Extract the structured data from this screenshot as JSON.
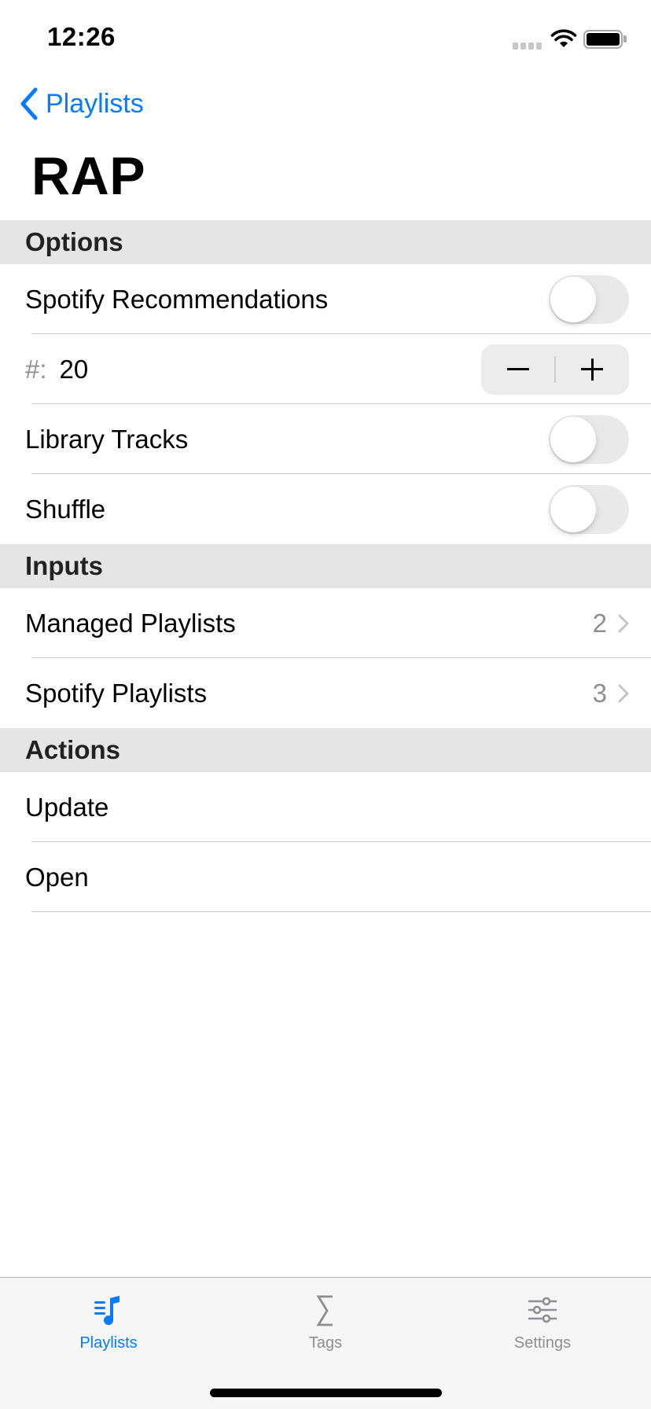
{
  "status_bar": {
    "time": "12:26"
  },
  "nav": {
    "back_label": "Playlists",
    "title": "RAP"
  },
  "sections": [
    {
      "header": "Options",
      "rows": [
        {
          "label": "Spotify Recommendations",
          "type": "toggle",
          "value": false
        },
        {
          "prefix": "#:",
          "label": "20",
          "type": "stepper",
          "value": 20
        },
        {
          "label": "Library Tracks",
          "type": "toggle",
          "value": false
        },
        {
          "label": "Shuffle",
          "type": "toggle",
          "value": false
        }
      ]
    },
    {
      "header": "Inputs",
      "rows": [
        {
          "label": "Managed Playlists",
          "type": "disclosure",
          "detail": "2"
        },
        {
          "label": "Spotify Playlists",
          "type": "disclosure",
          "detail": "3"
        }
      ]
    },
    {
      "header": "Actions",
      "rows": [
        {
          "label": "Update",
          "type": "action"
        },
        {
          "label": "Open",
          "type": "action"
        }
      ]
    }
  ],
  "tab_bar": {
    "tabs": [
      {
        "label": "Playlists",
        "icon": "music-list-icon",
        "active": true
      },
      {
        "label": "Tags",
        "icon": "sigma-icon",
        "active": false
      },
      {
        "label": "Settings",
        "icon": "sliders-icon",
        "active": false
      }
    ]
  },
  "colors": {
    "accent": "#0a7aff",
    "section_bg": "#e5e5e5",
    "muted": "#8e8e93",
    "tab_bar_bg": "#f6f6f6"
  }
}
